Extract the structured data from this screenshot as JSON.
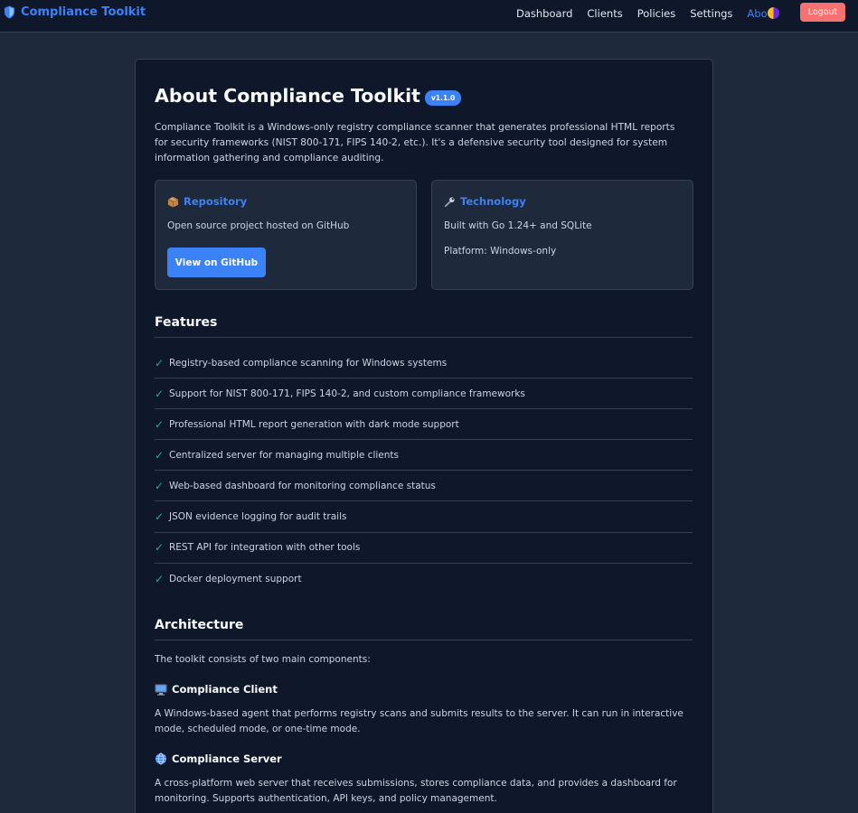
{
  "nav": {
    "brand": "Compliance Toolkit",
    "links": [
      "Dashboard",
      "Clients",
      "Policies",
      "Settings",
      "About"
    ],
    "active": "About",
    "logout_label": "Logout"
  },
  "about": {
    "title": "About Compliance Toolkit",
    "version": "v1.1.0",
    "intro": "Compliance Toolkit is a Windows-only registry compliance scanner that generates professional HTML reports for security frameworks (NIST 800-171, FIPS 140-2, etc.). It's a defensive security tool designed for system information gathering and compliance auditing.",
    "repository": {
      "icon": "package-icon",
      "title": "Repository",
      "text": "Open source project hosted on GitHub",
      "button": "View on GitHub"
    },
    "technology": {
      "icon": "wrench-icon",
      "title": "Technology",
      "built_with": "Built with Go 1.24+ and SQLite",
      "platform": "Platform: Windows-only"
    },
    "features_heading": "Features",
    "features": [
      "Registry-based compliance scanning for Windows systems",
      "Support for NIST 800-171, FIPS 140-2, and custom compliance frameworks",
      "Professional HTML report generation with dark mode support",
      "Centralized server for managing multiple clients",
      "Web-based dashboard for monitoring compliance status",
      "JSON evidence logging for audit trails",
      "REST API for integration with other tools",
      "Docker deployment support"
    ],
    "architecture_heading": "Architecture",
    "architecture_intro": "The toolkit consists of two main components:",
    "client": {
      "icon": "computer-icon",
      "title": "Compliance Client",
      "desc": "A Windows-based agent that performs registry scans and submits results to the server. It can run in interactive mode, scheduled mode, or one-time mode."
    },
    "server": {
      "icon": "globe-icon",
      "title": "Compliance Server",
      "desc": "A cross-platform web server that receives submissions, stores compliance data, and provides a dashboard for monitoring. Supports authentication, API keys, and policy management."
    }
  },
  "colors": {
    "accent": "#3b82f6",
    "check": "#10b981",
    "logout": "#f87171",
    "card_bg": "#0f172a",
    "page_bg": "#1e293b"
  }
}
